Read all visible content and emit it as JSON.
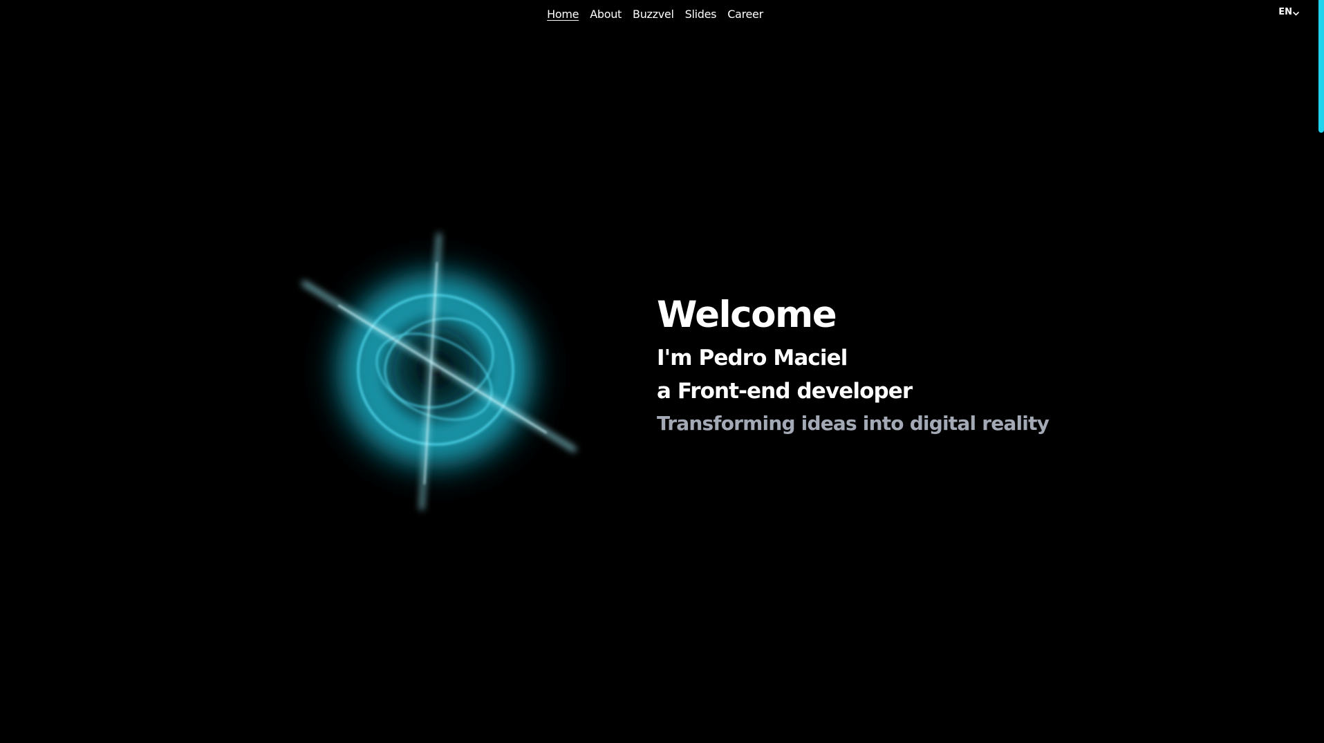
{
  "nav": {
    "items": [
      {
        "label": "Home",
        "active": true
      },
      {
        "label": "About",
        "active": false
      },
      {
        "label": "Buzzvel",
        "active": false
      },
      {
        "label": "Slides",
        "active": false
      },
      {
        "label": "Career",
        "active": false
      }
    ]
  },
  "language": {
    "selected": "EN"
  },
  "hero": {
    "title": "Welcome",
    "intro": "I'm Pedro Maciel",
    "role": "a Front-end developer",
    "tagline": "Transforming ideas into digital reality"
  },
  "colors": {
    "background": "#000000",
    "accent": "#22d3ee",
    "text": "#ffffff",
    "muted": "#a3aab6"
  }
}
